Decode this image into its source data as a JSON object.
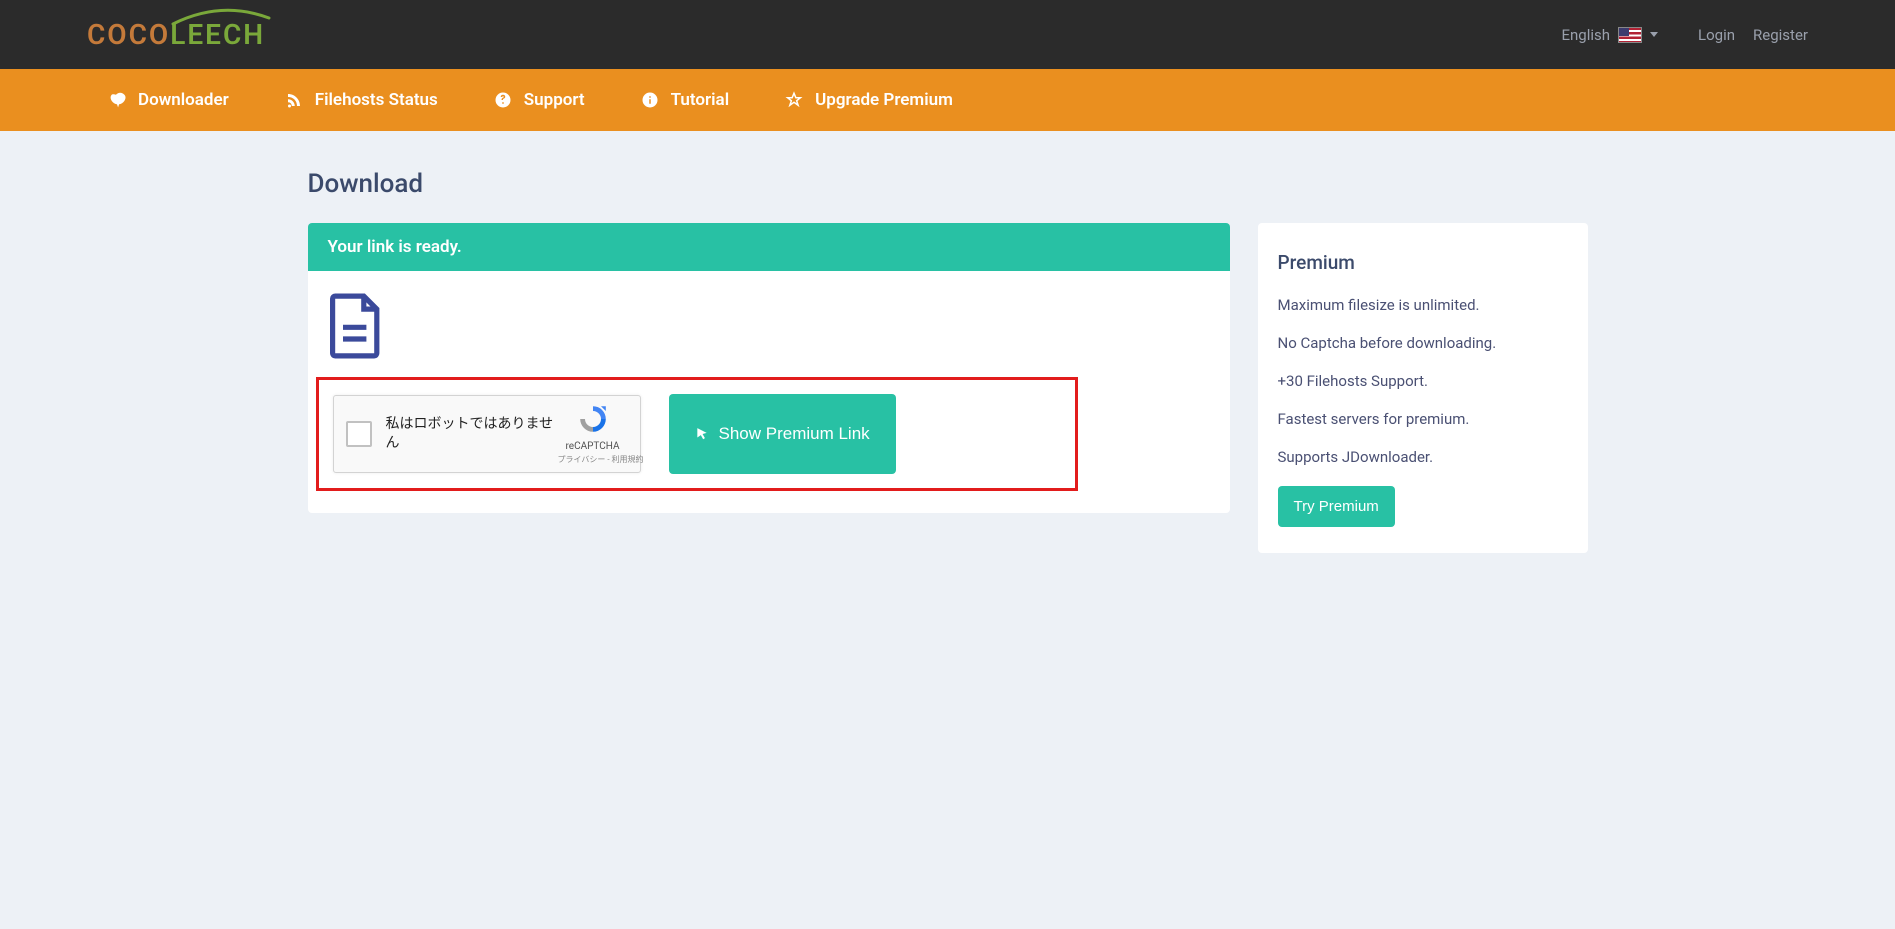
{
  "header": {
    "language_label": "English",
    "login_label": "Login",
    "register_label": "Register"
  },
  "nav": {
    "items": [
      {
        "label": "Downloader"
      },
      {
        "label": "Filehosts Status"
      },
      {
        "label": "Support"
      },
      {
        "label": "Tutorial"
      },
      {
        "label": "Upgrade Premium"
      }
    ]
  },
  "page": {
    "title": "Download"
  },
  "download_panel": {
    "header": "Your link is ready.",
    "recaptcha_label": "私はロボットではありません",
    "recaptcha_brand": "reCAPTCHA",
    "recaptcha_links": "プライバシー - 利用規約",
    "show_button": "Show Premium Link"
  },
  "premium_card": {
    "title": "Premium",
    "features": [
      "Maximum filesize is unlimited.",
      "No Captcha before downloading.",
      "+30 Filehosts Support.",
      "Fastest servers for premium.",
      "Supports JDownloader."
    ],
    "try_button": "Try Premium"
  }
}
